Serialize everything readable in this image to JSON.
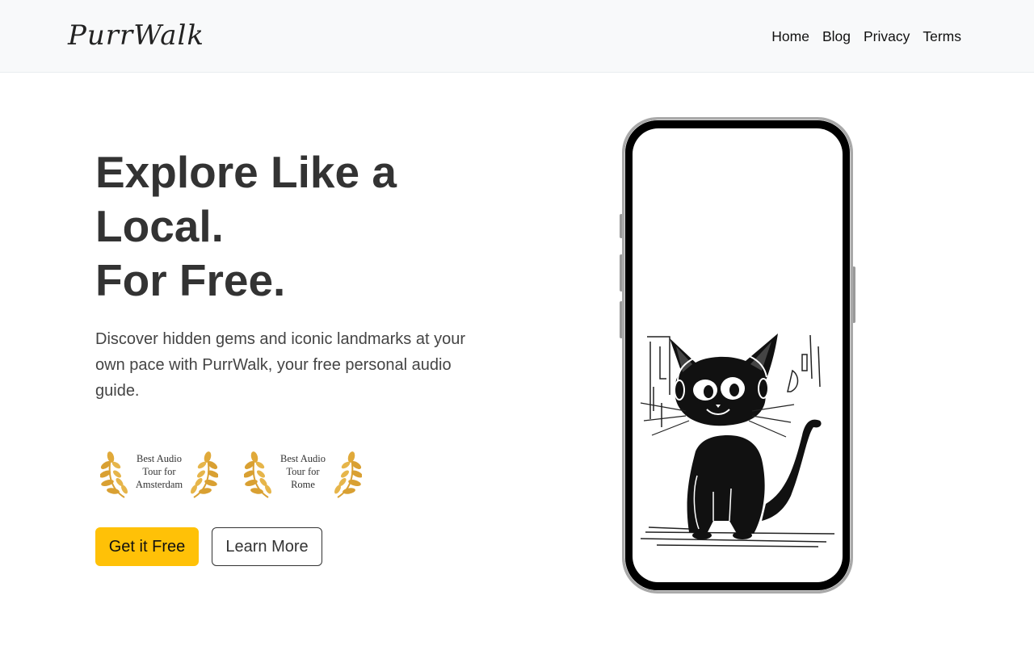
{
  "nav": {
    "brand": "PurrWalk",
    "links": [
      {
        "label": "Home"
      },
      {
        "label": "Blog"
      },
      {
        "label": "Privacy"
      },
      {
        "label": "Terms"
      }
    ]
  },
  "hero": {
    "title_line1": "Explore Like a",
    "title_line2": "Local.",
    "title_line3": "For Free.",
    "description": "Discover hidden gems and iconic landmarks at your own pace with PurrWalk, your free personal audio guide."
  },
  "awards": [
    {
      "line1": "Best Audio",
      "line2": "Tour for",
      "line3": "Amsterdam"
    },
    {
      "line1": "Best Audio",
      "line2": "Tour for",
      "line3": "Rome"
    }
  ],
  "buttons": {
    "primary_label": "Get it Free",
    "secondary_label": "Learn More"
  },
  "colors": {
    "accent": "#ffc107",
    "laurel": "#d9a032",
    "navbar_bg": "#f8f9fa",
    "heading": "#333333"
  },
  "icons": {
    "laurel": "laurel-wreath-icon",
    "phone_image": "cat-with-headphones-illustration"
  }
}
